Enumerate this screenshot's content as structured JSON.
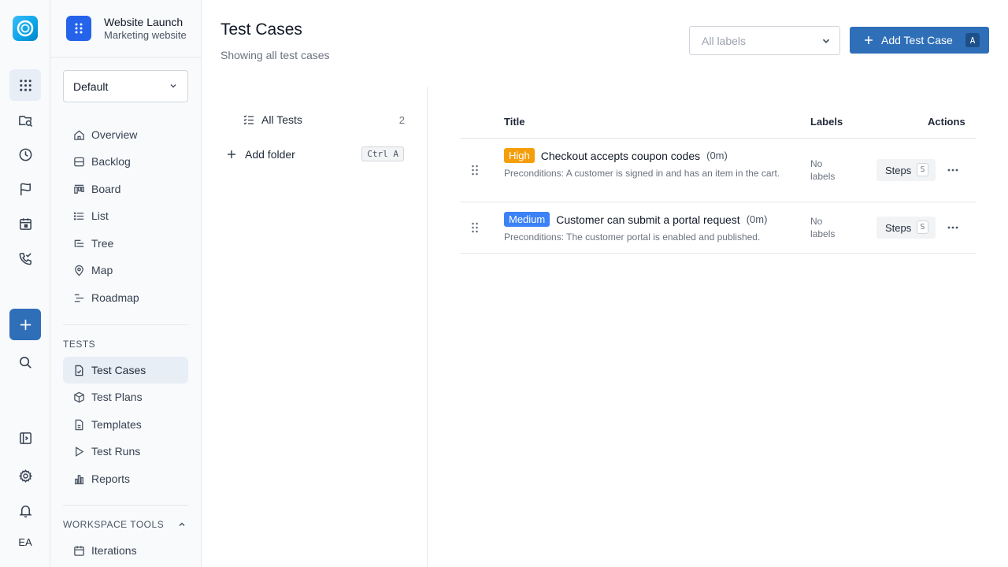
{
  "rail": {
    "initials": "EA",
    "icons": [
      "apps-grid-icon",
      "search-folder-icon",
      "clock-icon",
      "flag-icon",
      "calendar-icon",
      "phone-check-icon",
      "plus-icon",
      "search-icon",
      "sidebar-toggle-icon",
      "gear-icon",
      "bell-icon"
    ]
  },
  "project": {
    "name": "Website Launch",
    "subtitle": "Marketing website"
  },
  "view_select": {
    "value": "Default"
  },
  "nav": [
    {
      "label": "Overview",
      "icon": "home-icon"
    },
    {
      "label": "Backlog",
      "icon": "backlog-icon"
    },
    {
      "label": "Board",
      "icon": "board-icon"
    },
    {
      "label": "List",
      "icon": "list-icon"
    },
    {
      "label": "Tree",
      "icon": "tree-icon"
    },
    {
      "label": "Map",
      "icon": "map-pin-icon"
    },
    {
      "label": "Roadmap",
      "icon": "roadmap-icon"
    }
  ],
  "tests_section": {
    "label": "TESTS",
    "items": [
      {
        "label": "Test Cases",
        "icon": "test-case-icon",
        "active": true
      },
      {
        "label": "Test Plans",
        "icon": "cube-icon"
      },
      {
        "label": "Templates",
        "icon": "file-icon"
      },
      {
        "label": "Test Runs",
        "icon": "play-icon"
      },
      {
        "label": "Reports",
        "icon": "bar-chart-icon"
      }
    ]
  },
  "workspace_section": {
    "label": "WORKSPACE TOOLS",
    "items": [
      {
        "label": "Iterations",
        "icon": "calendar-icon"
      }
    ]
  },
  "main": {
    "title": "Test Cases",
    "subtitle": "Showing all test cases",
    "labels_filter_placeholder": "All labels",
    "add_button_label": "Add Test Case",
    "add_button_shortcut": "A"
  },
  "folders": {
    "all_tests_label": "All Tests",
    "all_tests_count": "2",
    "add_folder_label": "Add folder",
    "add_folder_shortcut": "Ctrl A"
  },
  "table": {
    "columns": [
      "Title",
      "Labels",
      "Actions"
    ],
    "rows": [
      {
        "priority": "High",
        "priority_color": "#f59e0b",
        "title": "Checkout accepts coupon codes",
        "duration": "(0m)",
        "preconditions": "Preconditions: A customer is signed in and has an item in the cart.",
        "labels": "No labels",
        "steps_label": "Steps",
        "steps_shortcut": "S"
      },
      {
        "priority": "Medium",
        "priority_color": "#3b82f6",
        "title": "Customer can submit a portal request",
        "duration": "(0m)",
        "preconditions": "Preconditions: The customer portal is enabled and published.",
        "labels": "No labels",
        "steps_label": "Steps",
        "steps_shortcut": "S"
      }
    ]
  },
  "colors": {
    "accent": "#2f6fb8",
    "active_bg": "#e8eef6",
    "project_badge": "#2563eb"
  }
}
